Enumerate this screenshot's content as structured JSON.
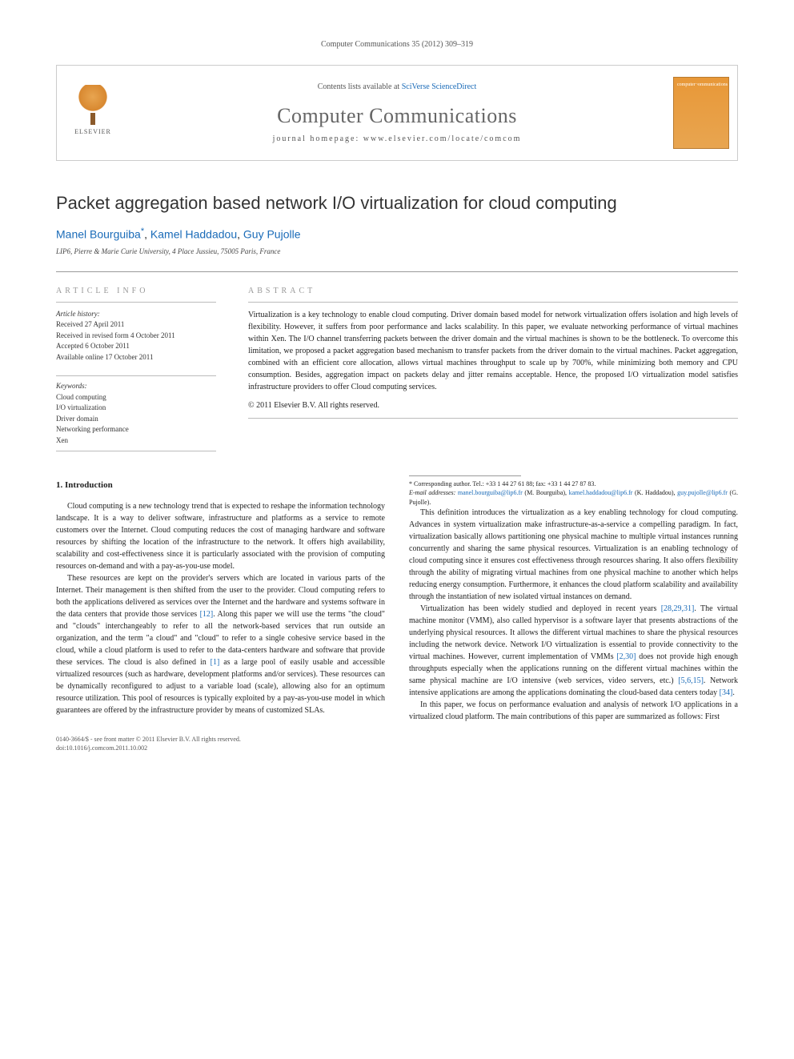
{
  "header_citation": "Computer Communications 35 (2012) 309–319",
  "banner": {
    "contents_text": "Contents lists available at ",
    "contents_link": "SciVerse ScienceDirect",
    "journal_name": "Computer Communications",
    "homepage": "journal homepage: www.elsevier.com/locate/comcom",
    "publisher_logo_text": "ELSEVIER"
  },
  "title": "Packet aggregation based network I/O virtualization for cloud computing",
  "authors": {
    "a1": "Manel Bourguiba",
    "a2": "Kamel Haddadou",
    "a3": "Guy Pujolle",
    "corr_mark": "*"
  },
  "affiliation": "LIP6, Pierre & Marie Curie University, 4 Place Jussieu, 75005 Paris, France",
  "info": {
    "article_info_label": "ARTICLE INFO",
    "abstract_label": "ABSTRACT",
    "history_label": "Article history:",
    "h1": "Received 27 April 2011",
    "h2": "Received in revised form 4 October 2011",
    "h3": "Accepted 6 October 2011",
    "h4": "Available online 17 October 2011",
    "kw_label": "Keywords:",
    "k1": "Cloud computing",
    "k2": "I/O virtualization",
    "k3": "Driver domain",
    "k4": "Networking performance",
    "k5": "Xen"
  },
  "abstract_text": "Virtualization is a key technology to enable cloud computing. Driver domain based model for network virtualization offers isolation and high levels of flexibility. However, it suffers from poor performance and lacks scalability. In this paper, we evaluate networking performance of virtual machines within Xen. The I/O channel transferring packets between the driver domain and the virtual machines is shown to be the bottleneck. To overcome this limitation, we proposed a packet aggregation based mechanism to transfer packets from the driver domain to the virtual machines. Packet aggregation, combined with an efficient core allocation, allows virtual machines throughput to scale up by 700%, while minimizing both memory and CPU consumption. Besides, aggregation impact on packets delay and jitter remains acceptable. Hence, the proposed I/O virtualization model satisfies infrastructure providers to offer Cloud computing services.",
  "copyright": "© 2011 Elsevier B.V. All rights reserved.",
  "section_heading": "1. Introduction",
  "body": {
    "p1a": "Cloud computing is a new technology trend that is expected to reshape the information technology landscape. It is a way to deliver software, infrastructure and platforms as a service to remote customers over the Internet. Cloud computing reduces the cost of managing hardware and software resources by shifting the location of the infrastructure to the network. It offers high availability, scalability and cost-effectiveness since it is particularly associated with the provision of computing resources on-demand and with a pay-as-you-use model.",
    "p2a": "These resources are kept on the provider's servers which are located in various parts of the Internet. Their management is then shifted from the user to the provider. Cloud computing refers to both the applications delivered as services over the Internet and the hardware and systems software in the data centers that provide those services ",
    "ref12": "[12]",
    "p2b": ". Along this paper we will use the terms \"the cloud\" and \"clouds\" interchangeably to refer to all the network-based services that run outside an organization, and the term \"a cloud\" and \"cloud\" to refer to a single cohesive service based in the cloud, while a cloud platform is used to refer to the data-centers hardware and software that provide these services. The cloud is also defined in ",
    "ref1": "[1]",
    "p2c": " as a large pool of easily usable and accessible virtualized resources (such as hardware, development platforms and/or services). These resources can be dynamically reconfigured to adjust to a variable load (scale), allowing also for an optimum resource utilization. This pool of resources is typically exploited by a pay-as-you-use model in which guarantees are offered by the infrastructure provider by means of customized SLAs.",
    "p3": "This definition introduces the virtualization as a key enabling technology for cloud computing. Advances in system virtualization make infrastructure-as-a-service a compelling paradigm. In fact, virtualization basically allows partitioning one physical machine to multiple virtual instances running concurrently and sharing the same physical resources. Virtualization is an enabling technology of cloud computing since it ensures cost effectiveness through resources sharing. It also offers flexibility through the ability of migrating virtual machines from one physical machine to another which helps reducing energy consumption. Furthermore, it enhances the cloud platform scalability and availability through the instantiation of new isolated virtual instances on demand.",
    "p4a": "Virtualization has been widely studied and deployed in recent years ",
    "ref28": "[28,29,31]",
    "p4b": ". The virtual machine monitor (VMM), also called hypervisor is a software layer that presents abstractions of the underlying physical resources. It allows the different virtual machines to share the physical resources including the network device. Network I/O virtualization is essential to provide connectivity to the virtual machines. However, current implementation of VMMs ",
    "ref2_30": "[2,30]",
    "p4c": " does not provide high enough throughputs especially when the applications running on the different virtual machines within the same physical machine are I/O intensive (web services, video servers, etc.) ",
    "ref5": "[5,6,15]",
    "p4d": ". Network intensive applications are among the applications dominating the cloud-based data centers today ",
    "ref34": "[34]",
    "p4e": ".",
    "p5": "In this paper, we focus on performance evaluation and analysis of network I/O applications in a virtualized cloud platform. The main contributions of this paper are summarized as follows: First"
  },
  "footnote": {
    "corr_text": "* Corresponding author. Tel.: +33 1 44 27 61 88; fax: +33 1 44 27 87 83.",
    "email_label": "E-mail addresses: ",
    "e1": "manel.bourguiba@lip6.fr",
    "e1_who": " (M. Bourguiba), ",
    "e2": "kamel.haddadou@lip6.fr",
    "e2_who": " (K. Haddadou), ",
    "e3": "guy.pujolle@lip6.fr",
    "e3_who": " (G. Pujolle)."
  },
  "footer": {
    "l1": "0140-3664/$ - see front matter © 2011 Elsevier B.V. All rights reserved.",
    "l2": "doi:10.1016/j.comcom.2011.10.002"
  }
}
